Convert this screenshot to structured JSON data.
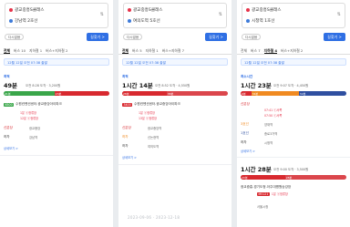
{
  "colors": {
    "start": "#e6334a",
    "end": "#3e7bd9",
    "primary": "#2f6fe4",
    "bus_red": "#d8292f",
    "bus_green": "#3aa64a",
    "bus_blue": "#2f6fe4",
    "subway_orange": "#f08a21"
  },
  "common": {
    "options_label": "다시없음",
    "directions_label": "길찾기 >",
    "origin": "광교중흥S클래스"
  },
  "panels": [
    {
      "destination": "강남역 2호선",
      "tabs": [
        "전체",
        "버스 10",
        "지하철 1",
        "버스+지하철 2"
      ],
      "date": "12월 12일 오전 07:38 출발",
      "route_badge": "최적",
      "route_time": "49분",
      "route_meta": "오전 8:28 도착 · 3,200원",
      "timeline": [
        "21분",
        "23분"
      ],
      "steps": [
        {
          "label": "수원컨벤션센터.광교중앙아이파크",
          "chip": "6500",
          "note": "1분 ⓒ정류장",
          "note2": "12분 ⓒ정류장"
        },
        {
          "label": "신분당",
          "chip": "",
          "note": "광교중앙",
          "note2": ""
        },
        {
          "label": "하차",
          "chip": "",
          "note": "강남역",
          "note2": ""
        }
      ],
      "details": "상세보기 >"
    },
    {
      "destination": "여의도역 5호선",
      "tabs": [
        "전체",
        "버스 5",
        "지하철 1",
        "버스+지하철 7"
      ],
      "date": "12월 12일 오전 07:38 출발",
      "route_badge": "최적",
      "route_time": "1시간 14분",
      "route_meta": "오전 8:52 도착 · 4,550원",
      "timeline": [
        "28분",
        "38분"
      ],
      "steps": [
        {
          "label": "수원컨벤션센터.광교중앙아이파크",
          "chip": "3400",
          "note": "1분 ⓒ정류장",
          "note2": "13분 ⓒ정류장"
        },
        {
          "label": "신분당",
          "chip": "",
          "note": "광교중앙역",
          "note2": ""
        },
        {
          "label": "하차",
          "chip": "",
          "note": "신논현역",
          "note2": ""
        },
        {
          "label": "하차",
          "chip": "",
          "note": "여의도역",
          "note2": ""
        }
      ],
      "details": "상세보기 >"
    },
    {
      "destination": "시청역 1호선",
      "tabs": [
        "전체",
        "버스 7",
        "지하철 4",
        "버스+지하철 2"
      ],
      "date": "12월 12일 오전 07:38 출발",
      "route_badge": "최소시간",
      "route_time": "1시간 23분",
      "route_meta": "오전 9:07 도착 · 4,450원",
      "timeline": [
        "6분",
        "34분",
        "32분"
      ],
      "steps": [
        {
          "label": "신분당",
          "chip": "",
          "note": "07:41 ⓒ서쪽",
          "note2": "07:50 ⓒ서쪽"
        },
        {
          "label": "3호선",
          "chip": "",
          "note": "양재역",
          "note2": ""
        },
        {
          "label": "1호선",
          "chip": "",
          "note": "종로3가역",
          "note2": ""
        },
        {
          "label": "하차",
          "chip": "",
          "note": "시청역",
          "note2": ""
        }
      ],
      "details": "상세보기 >",
      "route2_time": "1시간 28분",
      "route2_meta": "오전 9:00 도착 · 3,500원",
      "route2_timeline": [
        "20분",
        "28분"
      ],
      "route2_step": {
        "label": "광교중흥.경기도청.아주대병원승강장",
        "chip": "M5121",
        "note": "1분 ⓒ정류장"
      },
      "route2_dest": "서울시청"
    }
  ],
  "watermark": "2023-09-06 · 2023-12-18"
}
